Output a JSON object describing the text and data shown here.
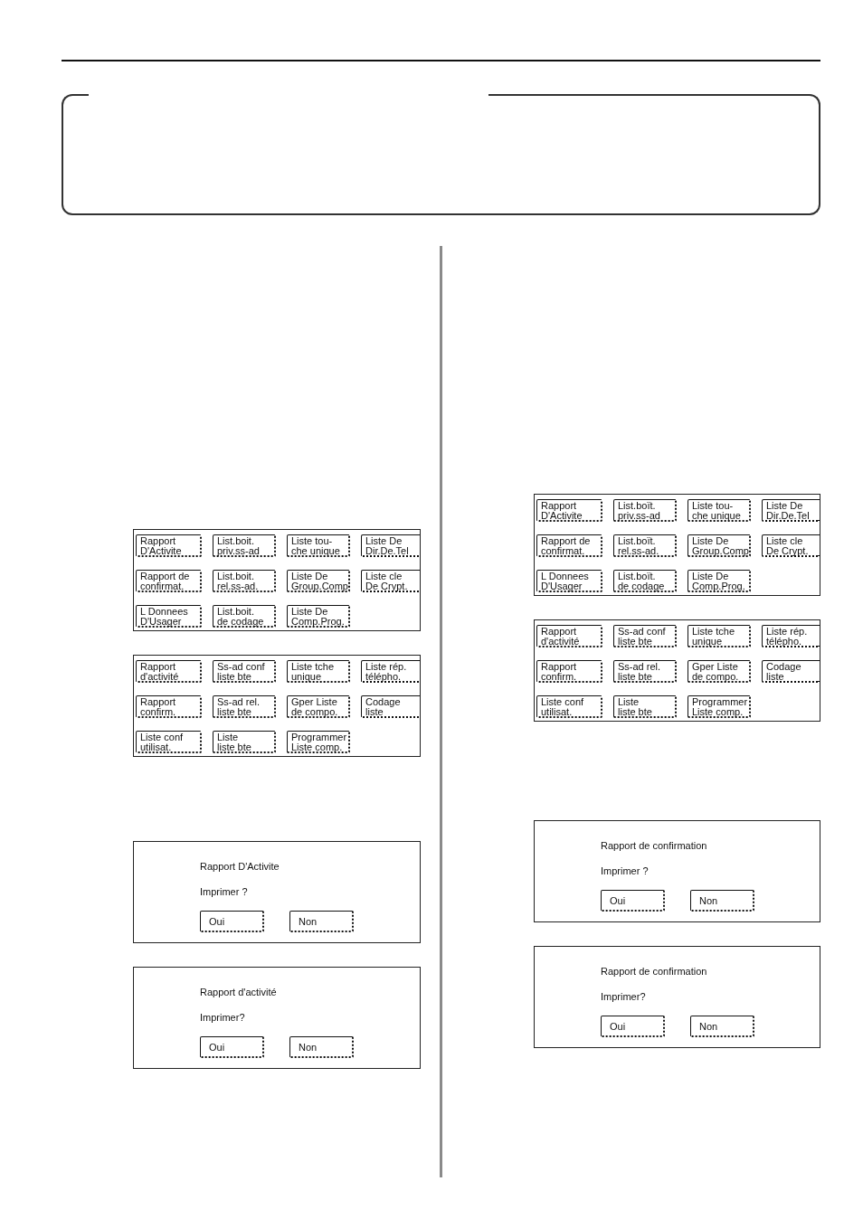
{
  "columns": [
    {
      "menu_screens": [
        {
          "buttons": [
            {
              "lines": [
                "Rapport",
                "D'Activite"
              ]
            },
            {
              "lines": [
                "List.boit.",
                "priv.ss-ad"
              ]
            },
            {
              "lines": [
                "Liste tou-",
                "che unique"
              ]
            },
            {
              "lines": [
                "Liste De",
                "Dir.De.Tel"
              ]
            },
            {
              "lines": [
                "Rapport de",
                "confirmat."
              ]
            },
            {
              "lines": [
                "List.boit.",
                "rel.ss-ad."
              ]
            },
            {
              "lines": [
                "Liste De",
                "Group.Comp"
              ]
            },
            {
              "lines": [
                "Liste cle",
                "De Crypt."
              ]
            },
            {
              "lines": [
                "L Donnees",
                "D'Usager"
              ]
            },
            {
              "lines": [
                "List.boit.",
                "de codage"
              ]
            },
            {
              "lines": [
                "Liste De",
                "Comp.Prog."
              ]
            }
          ]
        },
        {
          "buttons": [
            {
              "lines": [
                "Rapport",
                "d'activité"
              ]
            },
            {
              "lines": [
                "Ss-ad conf",
                "liste bte"
              ]
            },
            {
              "lines": [
                "Liste tche",
                "unique"
              ]
            },
            {
              "lines": [
                "Liste rép.",
                "télépho."
              ]
            },
            {
              "lines": [
                "Rapport",
                "confirm."
              ]
            },
            {
              "lines": [
                "Ss-ad rel.",
                "liste bte"
              ]
            },
            {
              "lines": [
                "Gper Liste",
                "de compo."
              ]
            },
            {
              "lines": [
                "Codage",
                "liste"
              ]
            },
            {
              "lines": [
                "Liste conf",
                "utilisat."
              ]
            },
            {
              "lines": [
                "Liste",
                "liste bte"
              ]
            },
            {
              "lines": [
                "Programmer",
                "Liste comp."
              ]
            }
          ]
        }
      ],
      "dialogs": [
        {
          "title": "Rapport D'Activite",
          "question": "Imprimer ?",
          "buttons": [
            {
              "label": "Oui"
            },
            {
              "label": "Non"
            }
          ]
        },
        {
          "title": "Rapport d'activité",
          "question": "Imprimer?",
          "buttons": [
            {
              "label": "Oui"
            },
            {
              "label": "Non"
            }
          ]
        }
      ]
    },
    {
      "menu_screens": [
        {
          "buttons": [
            {
              "lines": [
                "Rapport",
                "D'Activite"
              ]
            },
            {
              "lines": [
                "List.boït.",
                "priv.ss-ad"
              ]
            },
            {
              "lines": [
                "Liste tou-",
                "che unique"
              ]
            },
            {
              "lines": [
                "Liste De",
                "Dir.De.Tel"
              ]
            },
            {
              "lines": [
                "Rapport de",
                "confirmat."
              ]
            },
            {
              "lines": [
                "List.boït.",
                "rel.ss-ad."
              ]
            },
            {
              "lines": [
                "Liste De",
                "Group.Comp"
              ]
            },
            {
              "lines": [
                "Liste cle",
                "De Crypt."
              ]
            },
            {
              "lines": [
                "L Donnees",
                "D'Usager"
              ]
            },
            {
              "lines": [
                "List.boït.",
                "de codage"
              ]
            },
            {
              "lines": [
                "Liste De",
                "Comp.Prog."
              ]
            }
          ]
        },
        {
          "buttons": [
            {
              "lines": [
                "Rapport",
                "d'activité"
              ]
            },
            {
              "lines": [
                "Ss-ad conf",
                "liste bte"
              ]
            },
            {
              "lines": [
                "Liste tche",
                "unique"
              ]
            },
            {
              "lines": [
                "Liste rép.",
                "télépho."
              ]
            },
            {
              "lines": [
                "Rapport",
                "confirm."
              ]
            },
            {
              "lines": [
                "Ss-ad rel.",
                "liste bte"
              ]
            },
            {
              "lines": [
                "Gper Liste",
                "de compo."
              ]
            },
            {
              "lines": [
                "Codage",
                "liste"
              ]
            },
            {
              "lines": [
                "Liste conf",
                "utilisat."
              ]
            },
            {
              "lines": [
                "Liste",
                "liste bte"
              ]
            },
            {
              "lines": [
                "Programmer",
                "Liste comp."
              ]
            }
          ]
        }
      ],
      "dialogs": [
        {
          "title": "Rapport de confirmation",
          "question": "Imprimer ?",
          "buttons": [
            {
              "label": "Oui"
            },
            {
              "label": "Non"
            }
          ]
        },
        {
          "title": "Rapport de confirmation",
          "question": "Imprimer?",
          "buttons": [
            {
              "label": "Oui"
            },
            {
              "label": "Non"
            }
          ]
        }
      ]
    }
  ]
}
